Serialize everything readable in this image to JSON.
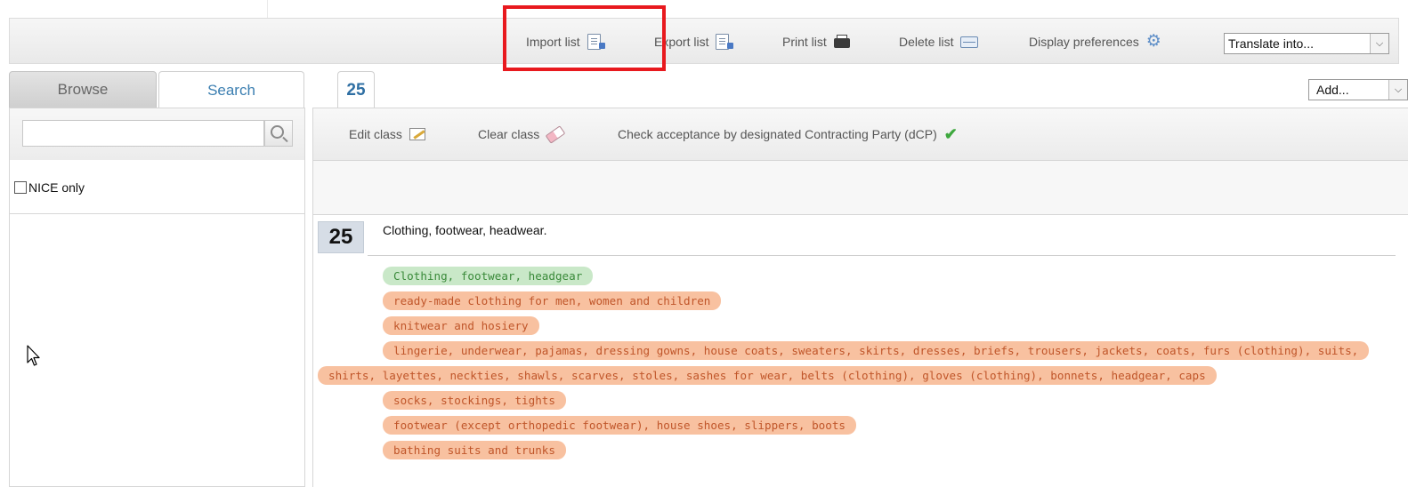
{
  "toolbar": {
    "import_label": "Import list",
    "export_label": "Export list",
    "print_label": "Print list",
    "delete_label": "Delete list",
    "display_prefs_label": "Display preferences",
    "translate_selected": "Translate into..."
  },
  "left_panel": {
    "tabs": [
      {
        "label": "Browse"
      },
      {
        "label": "Search"
      }
    ],
    "search_value": "",
    "nice_only_label": "NICE only"
  },
  "right_panel": {
    "class_tab_label": "25",
    "add_selected": "Add...",
    "class_toolbar": {
      "edit_label": "Edit class",
      "clear_label": "Clear class",
      "check_label": "Check acceptance by designated Contracting Party (dCP)"
    },
    "class_number": "25",
    "class_heading": "Clothing, footwear, headwear.",
    "terms": [
      "Clothing, footwear, headgear",
      "ready-made clothing for men, women and children",
      "knitwear and hosiery",
      "lingerie, underwear, pajamas, dressing gowns, house coats, sweaters, skirts, dresses, briefs, trousers, jackets, coats, furs (clothing), suits, shirts, layettes, neckties, shawls, scarves, stoles, sashes for wear, belts (clothing), gloves (clothing), bonnets, headgear, caps",
      "socks, stockings, tights",
      "footwear (except orthopedic footwear), house shoes, slippers, boots",
      "bathing suits and trunks"
    ]
  },
  "colors": {
    "highlight": "#e8191e",
    "term_green_bg": "#c9e8c8",
    "term_orange_bg": "#f8c1a0",
    "tab_active_text": "#3c7fb1"
  }
}
